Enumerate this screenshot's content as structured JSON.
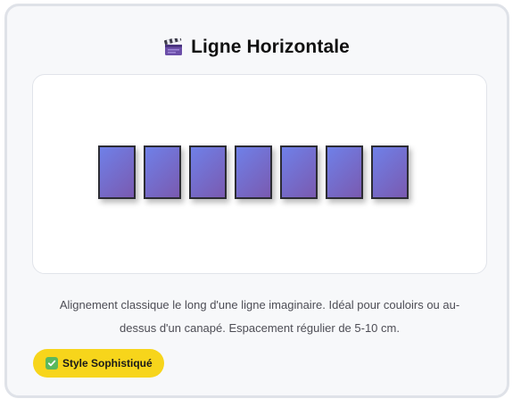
{
  "card": {
    "title_icon": "clapperboard-icon",
    "title": "Ligne Horizontale",
    "preview": {
      "frame_count": 7,
      "frame_colors": [
        "#6f80e8",
        "#7a5ab0"
      ],
      "frame_border_color": "#2c2c34"
    },
    "description_line1": "Alignement classique le long d'une ligne imaginaire. Idéal pour couloirs ou au-",
    "description_line2": "dessus d'un canapé. Espacement régulier de 5-10 cm.",
    "badge": {
      "icon": "check-icon",
      "label": "Style Sophistiqué",
      "color": "#f7d51b"
    }
  }
}
